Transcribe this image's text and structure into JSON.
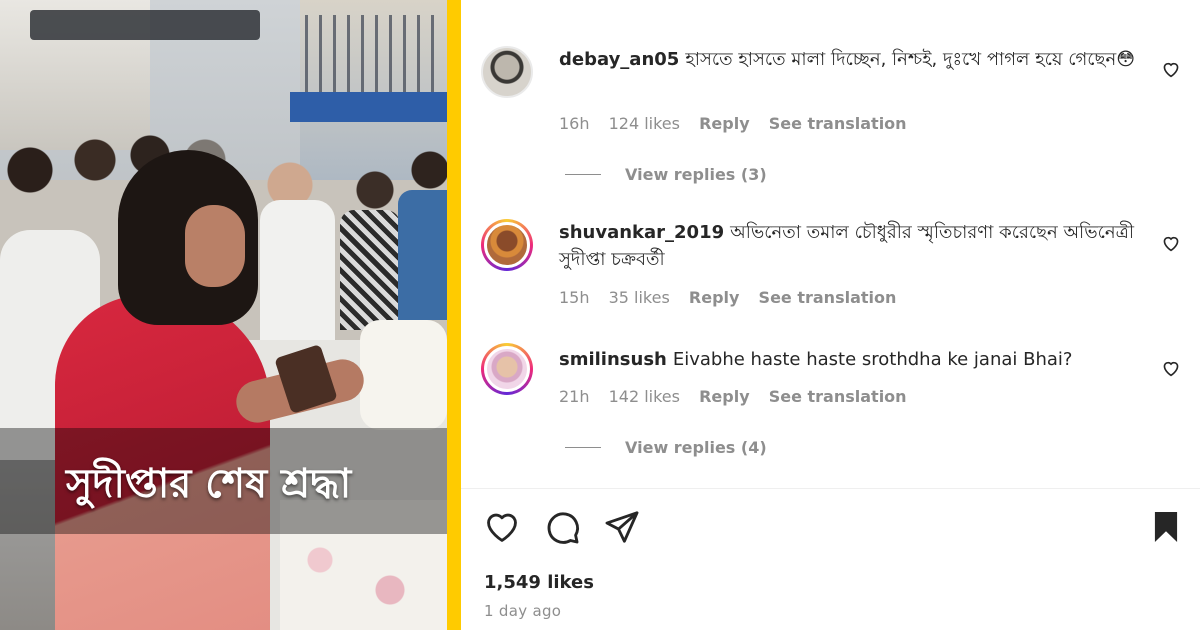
{
  "media": {
    "caption": "সুদীপ্তার শেষ শ্রদ্ধা"
  },
  "comments": [
    {
      "username": "debay_an05",
      "text": "হাসতে হাসতে মালা দিচ্ছেন, নিশ্চই, দুঃখে পাগল হয়ে গেছেন😳",
      "time": "16h",
      "likes": "124 likes",
      "reply": "Reply",
      "translate": "See translation",
      "view_replies": "View replies (3)"
    },
    {
      "username": "shuvankar_2019",
      "text": "অভিনেতা তমাল চৌধুরীর স্মৃতিচারণা করেছেন অভিনেত্রী সুদীপ্তা চক্রবর্তী",
      "time": "15h",
      "likes": "35 likes",
      "reply": "Reply",
      "translate": "See translation"
    },
    {
      "username": "smilinsush",
      "text": "Eivabhe haste haste srothdha ke janai Bhai?",
      "time": "21h",
      "likes": "142 likes",
      "reply": "Reply",
      "translate": "See translation",
      "view_replies": "View replies (4)"
    }
  ],
  "post": {
    "likes": "1,549 likes",
    "time_ago": "1 day ago"
  },
  "icons": {
    "like": "heart-icon",
    "comment": "comment-bubble-icon",
    "share": "paper-plane-icon",
    "save": "bookmark-filled-icon",
    "comment_like": "heart-outline-small-icon"
  },
  "colors": {
    "accent_divider": "#ffcb00",
    "muted_text": "#8e8e8e",
    "text": "#262626"
  }
}
